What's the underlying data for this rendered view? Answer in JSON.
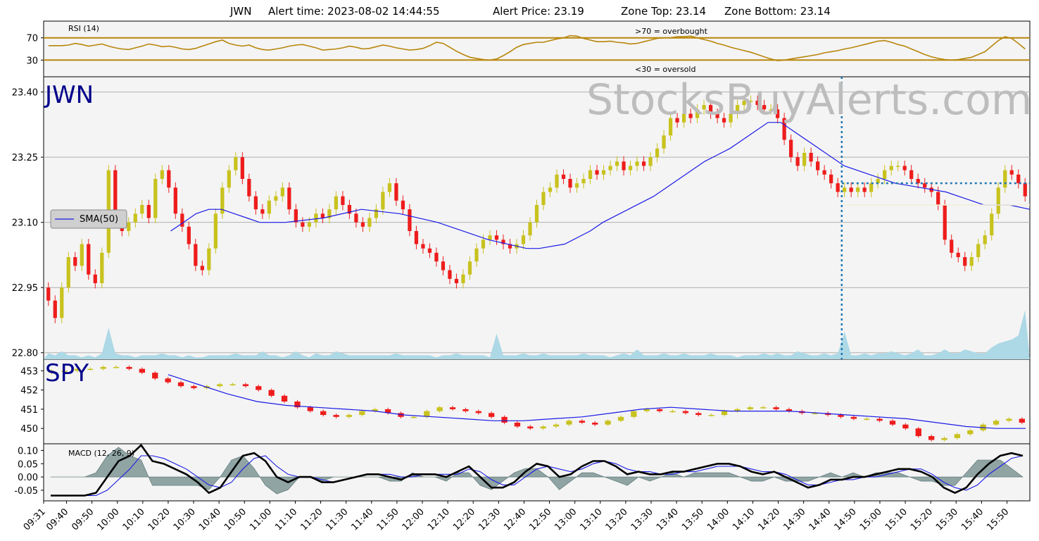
{
  "title": {
    "symbol": "JWN",
    "alert_time": "Alert time: 2023-08-02 14:44:55",
    "alert_price": "Alert Price: 23.19",
    "zone_top": "Zone Top: 23.14",
    "zone_bottom": "Zone Bottom: 23.14"
  },
  "watermark": "StocksBuyAlerts.com",
  "colors": {
    "up": "#c8c21e",
    "down": "#ee1c1c",
    "sma": "#1a1ae6",
    "rsi": "#b8860b",
    "volume": "#add8e6",
    "macd_line": "#000000",
    "signal_line": "#1a1ae6",
    "hist": "#6f8a8a",
    "alert_line": "#1f77b4",
    "panel_bg": "#f4f4f4",
    "grid": "#b0b0b0"
  },
  "chart_data": [
    {
      "type": "line",
      "panel": "rsi",
      "title": "RSI (14)",
      "annotations": [
        ">70 = overbought",
        "<30 = oversold"
      ],
      "yticks": [
        "70",
        "30"
      ],
      "ylim": [
        0,
        100
      ],
      "reference_lines": [
        70,
        30
      ],
      "series": [
        {
          "values": [
            56,
            56,
            56,
            57,
            60,
            58,
            55,
            57,
            59,
            55,
            52,
            50,
            49,
            52,
            55,
            59,
            57,
            54,
            55,
            53,
            50,
            49,
            51,
            55,
            59,
            63,
            66,
            60,
            57,
            55,
            57,
            52,
            49,
            48,
            50,
            52,
            55,
            57,
            58,
            55,
            52,
            48,
            49,
            50,
            52,
            55,
            53,
            50,
            51,
            54,
            57,
            55,
            52,
            50,
            48,
            49,
            51,
            56,
            62,
            60,
            53,
            46,
            40,
            35,
            33,
            31,
            30,
            32,
            38,
            45,
            53,
            58,
            60,
            62,
            62,
            65,
            68,
            70,
            74,
            73,
            69,
            66,
            63,
            63,
            64,
            62,
            61,
            59,
            60,
            63,
            66,
            69,
            70,
            70,
            72,
            72,
            73,
            70,
            67,
            64,
            60,
            57,
            53,
            50,
            47,
            44,
            40,
            36,
            32,
            29,
            30,
            32,
            34,
            36,
            38,
            40,
            43,
            45,
            47,
            50,
            52,
            55,
            58,
            61,
            64,
            65,
            62,
            58,
            55,
            50,
            45,
            40,
            36,
            33,
            31,
            30,
            31,
            33,
            35,
            40,
            45,
            55,
            65,
            72,
            69,
            60,
            50
          ]
        }
      ]
    },
    {
      "type": "candlestick",
      "panel": "price",
      "symbol": "JWN",
      "yticks": [
        "23.40",
        "23.25",
        "23.10",
        "22.95",
        "22.80"
      ],
      "ylim": [
        22.785,
        23.435
      ],
      "legend": "SMA(50)",
      "legend_position": "center-left",
      "alert_price": 23.19,
      "alert_time": "14:44:55",
      "zone_top": 23.14,
      "zone_bottom": 23.14,
      "close": [
        22.92,
        22.88,
        22.95,
        23.02,
        23.0,
        23.05,
        22.98,
        22.96,
        23.03,
        23.22,
        23.1,
        23.08,
        23.1,
        23.12,
        23.14,
        23.11,
        23.2,
        23.22,
        23.18,
        23.12,
        23.09,
        23.05,
        23.0,
        22.99,
        23.04,
        23.12,
        23.18,
        23.22,
        23.25,
        23.2,
        23.16,
        23.13,
        23.12,
        23.15,
        23.16,
        23.18,
        23.13,
        23.1,
        23.09,
        23.1,
        23.12,
        23.11,
        23.13,
        23.16,
        23.14,
        23.12,
        23.1,
        23.09,
        23.11,
        23.13,
        23.17,
        23.19,
        23.15,
        23.13,
        23.08,
        23.05,
        23.04,
        23.03,
        23.01,
        22.99,
        22.97,
        22.96,
        22.98,
        23.01,
        23.04,
        23.06,
        23.07,
        23.06,
        23.05,
        23.04,
        23.05,
        23.07,
        23.1,
        23.14,
        23.17,
        23.18,
        23.21,
        23.2,
        23.18,
        23.19,
        23.2,
        23.22,
        23.21,
        23.22,
        23.23,
        23.24,
        23.22,
        23.23,
        23.24,
        23.23,
        23.25,
        23.27,
        23.3,
        23.34,
        23.33,
        23.35,
        23.34,
        23.36,
        23.37,
        23.35,
        23.34,
        23.33,
        23.35,
        23.37,
        23.38,
        23.38,
        23.37,
        23.36,
        23.36,
        23.34,
        23.29,
        23.25,
        23.23,
        23.26,
        23.24,
        23.22,
        23.21,
        23.19,
        23.17,
        23.18,
        23.17,
        23.18,
        23.17,
        23.19,
        23.2,
        23.22,
        23.23,
        23.23,
        23.22,
        23.2,
        23.19,
        23.18,
        23.17,
        23.14,
        23.06,
        23.03,
        23.02,
        23.0,
        23.02,
        23.05,
        23.07,
        23.12,
        23.18,
        23.22,
        23.21,
        23.19,
        23.16
      ],
      "sma50": [
        23.08,
        23.1,
        23.12,
        23.13,
        23.13,
        23.12,
        23.11,
        23.1,
        23.1,
        23.11,
        23.13,
        23.12,
        23.1,
        23.06,
        23.04,
        23.04,
        23.05,
        23.08,
        23.1,
        23.13,
        23.16,
        23.2,
        23.24,
        23.27,
        23.29,
        23.31,
        23.33,
        23.33,
        23.31,
        23.27,
        23.23,
        23.21,
        23.19,
        23.18,
        23.17,
        23.16,
        23.15,
        23.14,
        23.14,
        23.13
      ],
      "sma50_times": [
        "10:21",
        "10:26",
        "10:31",
        "10:36",
        "10:41",
        "10:46",
        "10:51",
        "10:56",
        "11:06",
        "11:21",
        "11:36",
        "11:51",
        "12:06",
        "12:26",
        "12:41",
        "12:46",
        "12:56",
        "13:06",
        "13:11",
        "13:21",
        "13:31",
        "13:41",
        "13:51",
        "14:01",
        "14:06",
        "14:11",
        "14:16",
        "14:21",
        "14:26",
        "14:36",
        "14:46",
        "14:56",
        "15:06",
        "15:16",
        "15:26",
        "15:31",
        "15:36",
        "15:41",
        "15:51",
        "15:59"
      ],
      "volume": [
        3,
        2,
        4,
        2,
        2,
        1,
        2,
        1,
        3,
        16,
        3,
        2,
        2,
        1,
        2,
        2,
        2,
        3,
        2,
        2,
        1,
        2,
        1,
        1,
        2,
        2,
        2,
        2,
        3,
        2,
        2,
        2,
        4,
        2,
        2,
        1,
        2,
        4,
        2,
        1,
        3,
        2,
        2,
        4,
        3,
        2,
        2,
        2,
        2,
        2,
        2,
        2,
        3,
        2,
        2,
        2,
        2,
        2,
        1,
        2,
        2,
        3,
        2,
        2,
        2,
        2,
        1,
        13,
        2,
        2,
        2,
        3,
        2,
        2,
        3,
        2,
        2,
        2,
        2,
        2,
        3,
        2,
        2,
        2,
        1,
        2,
        3,
        2,
        5,
        2,
        2,
        2,
        3,
        2,
        2,
        3,
        2,
        2,
        2,
        3,
        2,
        2,
        2,
        1,
        2,
        2,
        2,
        3,
        2,
        3,
        2,
        2,
        4,
        3,
        2,
        2,
        3,
        2,
        3,
        14,
        2,
        2,
        3,
        2,
        3,
        3,
        4,
        3,
        2,
        3,
        5,
        2,
        2,
        3,
        5,
        3,
        3,
        5,
        4,
        3,
        3,
        6,
        8,
        9,
        10,
        12,
        25
      ]
    },
    {
      "type": "candlestick",
      "panel": "spy",
      "symbol": "SPY",
      "yticks": [
        "453",
        "452",
        "451",
        "450"
      ],
      "ylim": [
        449.2,
        453.6
      ],
      "close": [
        453.0,
        453.0,
        453.1,
        453.1,
        453.2,
        453.2,
        453.1,
        452.9,
        452.6,
        452.4,
        452.2,
        452.1,
        452.2,
        452.3,
        452.3,
        452.2,
        452.0,
        451.7,
        451.4,
        451.1,
        450.9,
        450.7,
        450.6,
        450.7,
        450.9,
        451.0,
        450.8,
        450.6,
        450.6,
        450.9,
        451.1,
        451.0,
        450.9,
        450.8,
        450.6,
        450.3,
        450.1,
        450.0,
        450.1,
        450.2,
        450.4,
        450.3,
        450.2,
        450.4,
        450.6,
        450.9,
        451.0,
        450.9,
        450.9,
        450.8,
        450.7,
        450.7,
        450.9,
        451.0,
        451.1,
        451.1,
        451.0,
        450.9,
        450.8,
        450.8,
        450.7,
        450.6,
        450.5,
        450.5,
        450.4,
        450.2,
        450.0,
        449.6,
        449.4,
        449.5,
        449.7,
        449.9,
        450.2,
        450.4,
        450.5,
        450.3
      ],
      "sma50": [
        452.8,
        452.3,
        451.8,
        451.4,
        451.2,
        451.1,
        451.0,
        450.9,
        450.7,
        450.6,
        450.5,
        450.4,
        450.4,
        450.5,
        450.6,
        450.8,
        451.0,
        451.1,
        451.0,
        450.9,
        450.9,
        450.9,
        450.8,
        450.7,
        450.6,
        450.5,
        450.3,
        450.1,
        450.0,
        450.0
      ]
    },
    {
      "type": "line",
      "panel": "macd",
      "title": "MACD (12, 26, 9)",
      "yticks": [
        "0.10",
        "0.05",
        "0.00",
        "-0.05"
      ],
      "ylim": [
        -0.09,
        0.125
      ],
      "series": [
        {
          "values": [
            -0.07,
            -0.07,
            -0.07,
            -0.07,
            -0.06,
            0.0,
            0.06,
            0.08,
            0.12,
            0.06,
            0.05,
            0.03,
            0.01,
            -0.02,
            -0.06,
            -0.04,
            0.02,
            0.08,
            0.09,
            0.06,
            0.0,
            -0.02,
            0.0,
            0.0,
            -0.02,
            -0.02,
            -0.01,
            0.0,
            0.01,
            0.01,
            0.0,
            -0.01,
            0.01,
            0.01,
            0.01,
            0.0,
            0.02,
            0.04,
            0.0,
            -0.04,
            -0.04,
            -0.02,
            0.02,
            0.05,
            0.04,
            0.0,
            0.01,
            0.04,
            0.06,
            0.06,
            0.04,
            0.01,
            0.02,
            0.01,
            0.01,
            0.02,
            0.02,
            0.03,
            0.04,
            0.05,
            0.05,
            0.04,
            0.02,
            0.01,
            0.02,
            0.0,
            -0.02,
            -0.04,
            -0.03,
            -0.01,
            -0.01,
            0.0,
            0.0,
            0.01,
            0.02,
            0.03,
            0.03,
            0.02,
            0.0,
            -0.04,
            -0.06,
            -0.04,
            0.01,
            0.05,
            0.08,
            0.09,
            0.08
          ]
        },
        {
          "values": [
            -0.07,
            -0.07,
            -0.07,
            -0.07,
            -0.07,
            -0.05,
            -0.01,
            0.03,
            0.08,
            0.08,
            0.07,
            0.05,
            0.03,
            0.0,
            -0.03,
            -0.04,
            -0.02,
            0.03,
            0.07,
            0.08,
            0.04,
            0.01,
            0.0,
            0.0,
            -0.01,
            -0.02,
            -0.01,
            0.0,
            0.01,
            0.01,
            0.01,
            0.0,
            0.0,
            0.01,
            0.01,
            0.01,
            0.01,
            0.03,
            0.02,
            -0.01,
            -0.03,
            -0.03,
            0.0,
            0.03,
            0.04,
            0.03,
            0.02,
            0.03,
            0.05,
            0.06,
            0.05,
            0.03,
            0.02,
            0.02,
            0.01,
            0.01,
            0.02,
            0.02,
            0.03,
            0.04,
            0.04,
            0.04,
            0.03,
            0.02,
            0.02,
            0.01,
            -0.01,
            -0.03,
            -0.03,
            -0.02,
            -0.01,
            -0.01,
            0.0,
            0.0,
            0.01,
            0.02,
            0.03,
            0.03,
            0.01,
            -0.02,
            -0.04,
            -0.05,
            -0.03,
            0.01,
            0.04,
            0.07,
            0.08
          ]
        }
      ]
    }
  ],
  "x_axis": {
    "ticks": [
      "09:31",
      "09:40",
      "09:50",
      "10:00",
      "10:10",
      "10:20",
      "10:30",
      "10:40",
      "10:50",
      "11:00",
      "11:10",
      "11:20",
      "11:30",
      "11:40",
      "11:50",
      "12:00",
      "12:10",
      "12:20",
      "12:30",
      "12:40",
      "12:50",
      "13:00",
      "13:10",
      "13:20",
      "13:30",
      "13:40",
      "13:50",
      "14:00",
      "14:10",
      "14:20",
      "14:30",
      "14:40",
      "14:50",
      "15:00",
      "15:10",
      "15:20",
      "15:30",
      "15:40",
      "15:50"
    ]
  }
}
